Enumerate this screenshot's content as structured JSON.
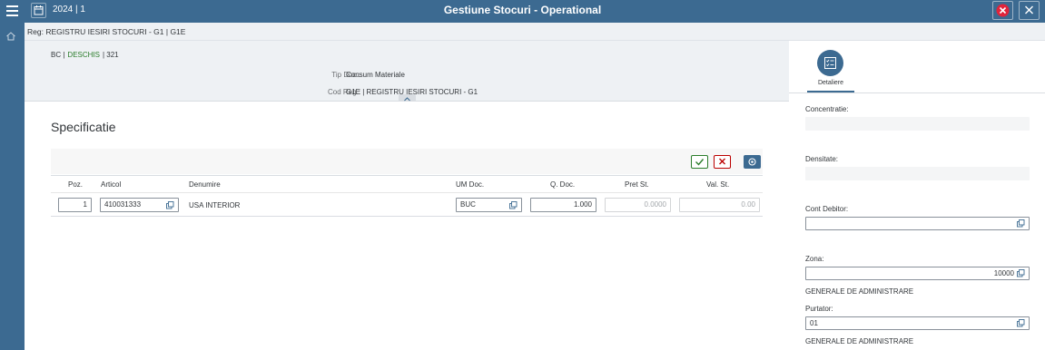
{
  "header_bar": {
    "period": "2024 | 1",
    "title": "Gestiune Stocuri - Operational",
    "menu_icon": "menu-icon",
    "calendar_icon": "calendar-icon",
    "cancel_icon": "cancel-circle-icon",
    "close_icon": "close-icon",
    "bar_color": "#3c6a91",
    "cancel_color": "#e0243b"
  },
  "breadcrumb": "Reg: REGISTRU IESIRI STOCURI - G1 | G1E",
  "doc_header": {
    "doc_type_code": "BC |",
    "status": "DESCHIS",
    "number": "| 321",
    "status_color": "#2b7d2b",
    "fields": [
      {
        "label": "Tip Doc.:",
        "value": "Consum Materiale"
      },
      {
        "label": "Cod Reg.:",
        "value": "G1E | REGISTRU IESIRI STOCURI - G1"
      }
    ]
  },
  "specificatie": {
    "title": "Specificatie",
    "columns": {
      "poz": "Poz.",
      "articol": "Articol",
      "denumire": "Denumire",
      "um_doc": "UM Doc.",
      "q_doc": "Q. Doc.",
      "pret_st": "Pret St.",
      "val_st": "Val. St."
    },
    "rows": [
      {
        "poz": "1",
        "articol": "410031333",
        "denumire": "USA INTERIOR",
        "um_doc": "BUC",
        "q_doc": "1.000",
        "pret_st": "0.0000",
        "val_st": "0.00"
      }
    ]
  },
  "side_panel": {
    "tab_label": "Detaliere",
    "tab_icon": "form-icon",
    "fields": {
      "concentratie": {
        "label": "Concentratie:",
        "value": ""
      },
      "densitate": {
        "label": "Densitate:",
        "value": ""
      },
      "cont_debitor": {
        "label": "Cont Debitor:",
        "value": ""
      },
      "zona": {
        "label": "Zona:",
        "value": "10000",
        "description": "GENERALE DE ADMINISTRARE"
      },
      "purtator": {
        "label": "Purtator:",
        "value": "01",
        "description": "GENERALE DE ADMINISTRARE"
      }
    }
  }
}
